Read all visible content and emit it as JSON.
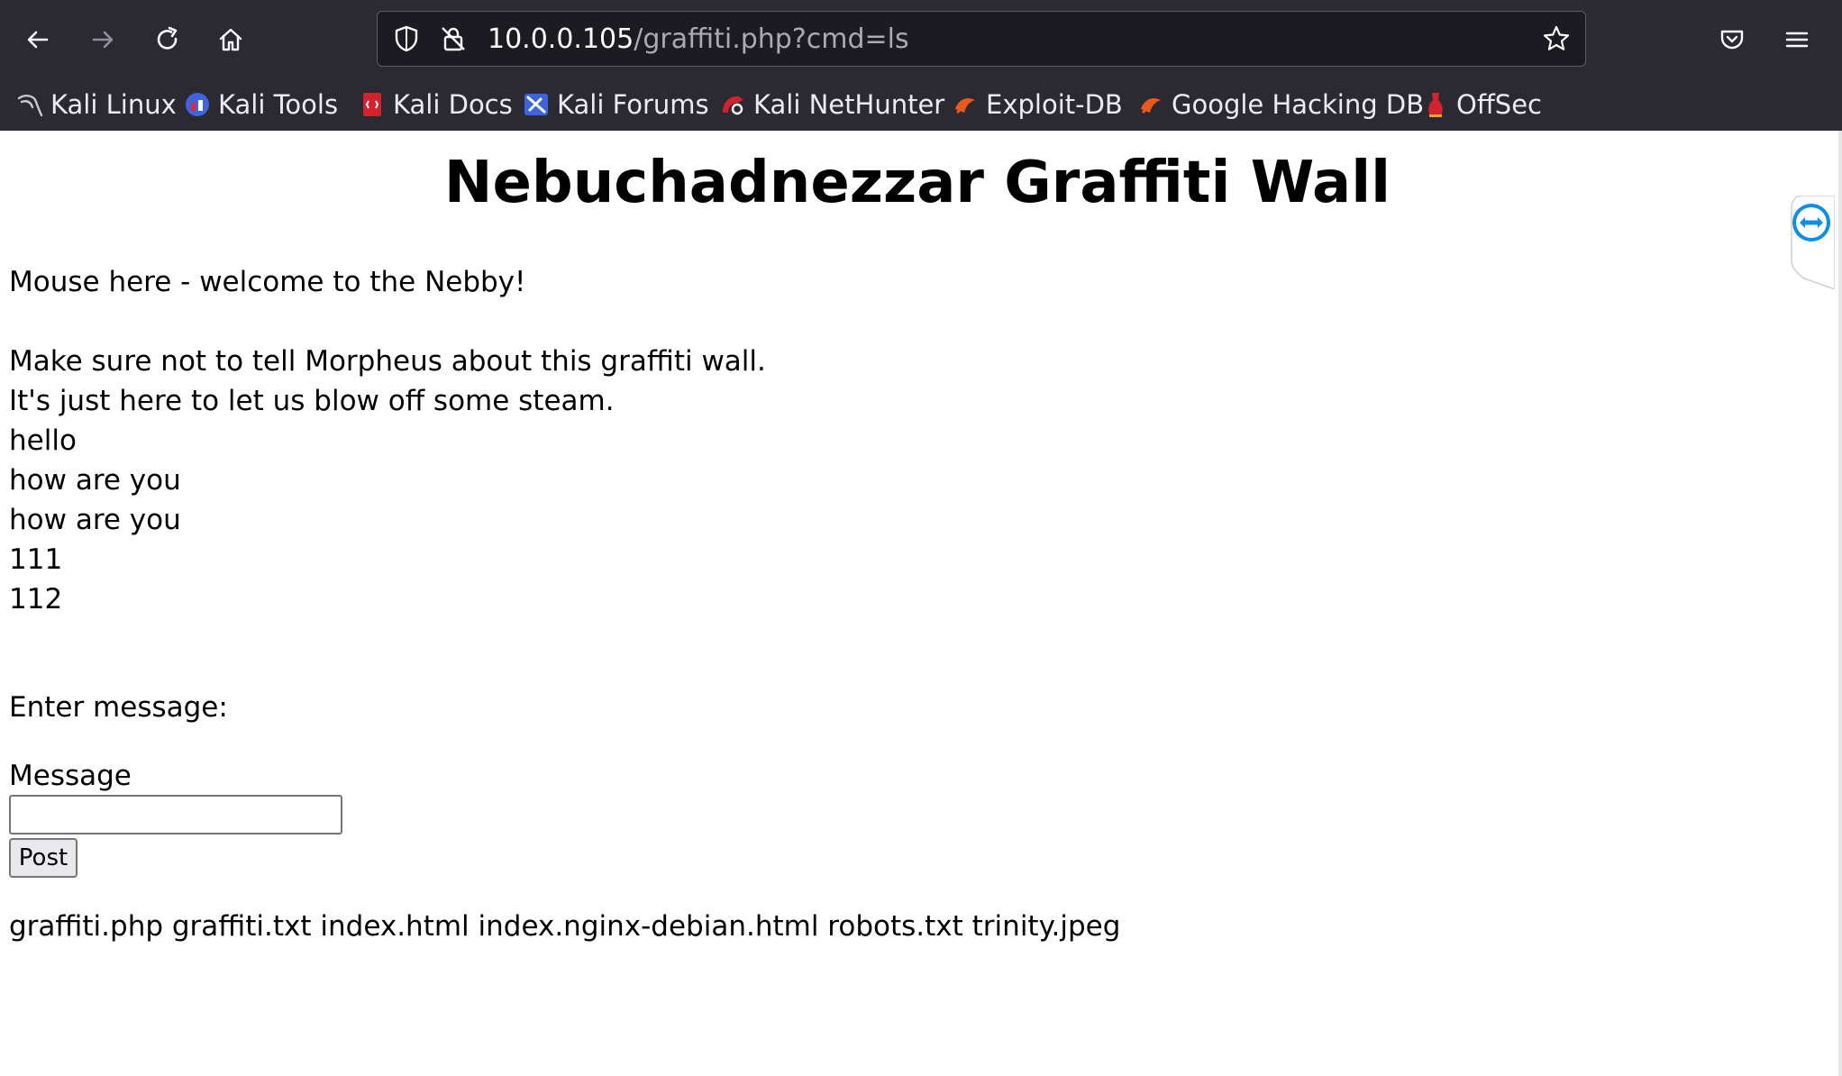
{
  "browser": {
    "url_host": "10.0.0.105",
    "url_path": "/graffiti.php?cmd=ls",
    "icons": [
      "back-arrow-icon",
      "forward-arrow-icon",
      "reload-icon",
      "home-icon",
      "shield-icon",
      "insecure-lock-icon",
      "bookmark-star-icon",
      "pocket-icon",
      "hamburger-menu-icon"
    ],
    "bookmarks": [
      {
        "label": "Kali Linux",
        "icon": "kali-dragon-icon"
      },
      {
        "label": "Kali Tools",
        "icon": "kali-tools-icon"
      },
      {
        "label": "Kali Docs",
        "icon": "kali-docs-icon"
      },
      {
        "label": "Kali Forums",
        "icon": "kali-forums-icon"
      },
      {
        "label": "Kali NetHunter",
        "icon": "nethunter-icon"
      },
      {
        "label": "Exploit-DB",
        "icon": "exploit-db-icon"
      },
      {
        "label": "Google Hacking DB",
        "icon": "ghdb-icon"
      },
      {
        "label": "OffSec",
        "icon": "offsec-icon"
      }
    ]
  },
  "page": {
    "title": "Nebuchadnezzar Graffiti Wall",
    "welcome": "Mouse here - welcome to the Nebby!",
    "graffiti_lines": [
      "Make sure not to tell Morpheus about this graffiti wall.",
      "It's just here to let us blow off some steam.",
      "hello",
      "how are you",
      "how are you",
      "111",
      "112"
    ],
    "form": {
      "heading": "Enter message:",
      "field_label": "Message",
      "field_value": "",
      "submit_label": "Post"
    },
    "command_output": "graffiti.php graffiti.txt index.html index.nginx-debian.html robots.txt trinity.jpeg"
  },
  "colors": {
    "chrome_bg": "#2b2a33",
    "urlbar_bg": "#1c1b22",
    "page_bg": "#ffffff",
    "side_tab_accent": "#0e8ee9"
  }
}
